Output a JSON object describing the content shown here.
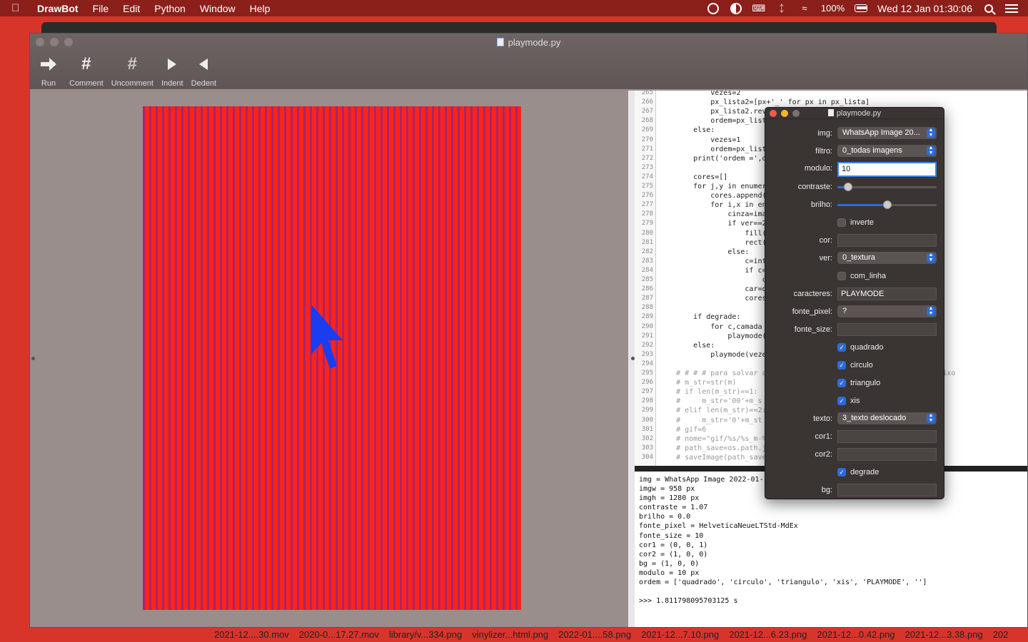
{
  "menubar": {
    "app": "DrawBot",
    "items": [
      "File",
      "Edit",
      "Python",
      "Window",
      "Help"
    ],
    "battery": "100%",
    "datetime": "Wed 12 Jan  01:30:06"
  },
  "window": {
    "title": "playmode.py",
    "toolbar": [
      {
        "label": "Run",
        "icon": "run-arrow-icon"
      },
      {
        "label": "Comment",
        "icon": "hash-icon"
      },
      {
        "label": "Uncomment",
        "icon": "uncomment-hash-icon"
      },
      {
        "label": "Indent",
        "icon": "indent-triangle-icon"
      },
      {
        "label": "Dedent",
        "icon": "dedent-triangle-icon"
      }
    ]
  },
  "code": {
    "lines": [
      {
        "n": "265",
        "t": "            vezes=2"
      },
      {
        "n": "266",
        "t": "            px_lista2=[px+'_' for px in px_lista]"
      },
      {
        "n": "267",
        "t": "            px_lista2.rev"
      },
      {
        "n": "268",
        "t": "            ordem=px_list"
      },
      {
        "n": "269",
        "t": "        else:"
      },
      {
        "n": "270",
        "t": "            vezes=1"
      },
      {
        "n": "271",
        "t": "            ordem=px_list"
      },
      {
        "n": "272",
        "t": "        print('ordem =',o"
      },
      {
        "n": "273",
        "t": ""
      },
      {
        "n": "274",
        "t": "        cores=[]"
      },
      {
        "n": "275",
        "t": "        for j,y in enumer"
      },
      {
        "n": "276",
        "t": "            cores.append("
      },
      {
        "n": "277",
        "t": "            for i,x in en"
      },
      {
        "n": "278",
        "t": "                cinza=ima"
      },
      {
        "n": "279",
        "t": "                if ver==2"
      },
      {
        "n": "280",
        "t": "                    fill("
      },
      {
        "n": "281",
        "t": "                    rect("
      },
      {
        "n": "282",
        "t": "                else:"
      },
      {
        "n": "283",
        "t": "                    c=int"
      },
      {
        "n": "284",
        "t": "                    if c="
      },
      {
        "n": "285",
        "t": "                        c"
      },
      {
        "n": "286",
        "t": "                    car=o"
      },
      {
        "n": "287",
        "t": "                    cores"
      },
      {
        "n": "288",
        "t": ""
      },
      {
        "n": "289",
        "t": "        if degrade:"
      },
      {
        "n": "290",
        "t": "            for c,camada"
      },
      {
        "n": "291",
        "t": "                playmode("
      },
      {
        "n": "292",
        "t": "        else:"
      },
      {
        "n": "293",
        "t": "            playmode(veze"
      },
      {
        "n": "294",
        "t": ""
      },
      {
        "n": "295",
        "t": "    # # # # para salvar a                                      abaixo"
      },
      {
        "n": "296",
        "t": "    # m_str=str(m)"
      },
      {
        "n": "297",
        "t": "    # if len(m_str)==1:"
      },
      {
        "n": "298",
        "t": "    #     m_str='00'+m_s"
      },
      {
        "n": "299",
        "t": "    # elif len(m_str)==2:"
      },
      {
        "n": "300",
        "t": "    #     m_str='0'+m_st"
      },
      {
        "n": "301",
        "t": "    # gif=6"
      },
      {
        "n": "302",
        "t": "    # nome=\"gif/%s/%s_m-%"
      },
      {
        "n": "303",
        "t": "    # path_save=os.path.j"
      },
      {
        "n": "304",
        "t": "    # saveImage(path_save"
      }
    ]
  },
  "output": {
    "text": "img = WhatsApp Image 2022-01-1\nimgw = 958 px\nimgh = 1280 px\ncontraste = 1.07\nbrilho = 0.0\nfonte_pixel = HelveticaNeueLTStd-MdEx\nfonte_size = 10\ncor1 = (0, 0, 1)\ncor2 = (1, 0, 0)\nbg = (1, 0, 0)\nmodulo = 10 px\nordem = ['quadrado', 'circulo', 'triangulo', 'xis', 'PLAYMODE', '']\n\n>>> 1.811798095703125 s"
  },
  "panel": {
    "title": "playmode.py",
    "img_label": "img:",
    "img_value": "WhatsApp Image 20...",
    "filtro_label": "filtro:",
    "filtro_value": "0_todas imagens",
    "modulo_label": "modulo:",
    "modulo_value": "10",
    "contraste_label": "contraste:",
    "contraste_level": 0.07,
    "brilho_label": "brilho:",
    "brilho_level": 0.5,
    "inverte_label": "inverte",
    "inverte_checked": false,
    "cor_label": "cor:",
    "ver_label": "ver:",
    "ver_value": "0_textura",
    "com_linha_label": "com_linha",
    "com_linha_checked": false,
    "caracteres_label": "caracteres:",
    "caracteres_value": "PLAYMODE",
    "fonte_pixel_label": "fonte_pixel:",
    "fonte_pixel_value": "?",
    "fonte_size_label": "fonte_size:",
    "quadrado_label": "quadrado",
    "circulo_label": "circulo",
    "triangulo_label": "triangulo",
    "xis_label": "xis",
    "texto_label": "texto:",
    "texto_value": "3_texto deslocado",
    "cor1_label": "cor1:",
    "cor2_label": "cor2:",
    "degrade_label": "degrade",
    "bg_label": "bg:"
  },
  "files": [
    "2021-12....30.mov",
    "2020-0...17.27.mov",
    "library/v...334.png",
    "vinylizer...html.png",
    "2022-01....58.png",
    "2021-12...7.10.png",
    "2021-12...6.23.png",
    "2021-12...0.42.png",
    "2021-12...3.38.png",
    "202"
  ],
  "colors": {
    "artboard": "#ff2318",
    "pattern": "#3c28dc",
    "accent": "#2d6bd9",
    "desktop": "#d8352a"
  }
}
